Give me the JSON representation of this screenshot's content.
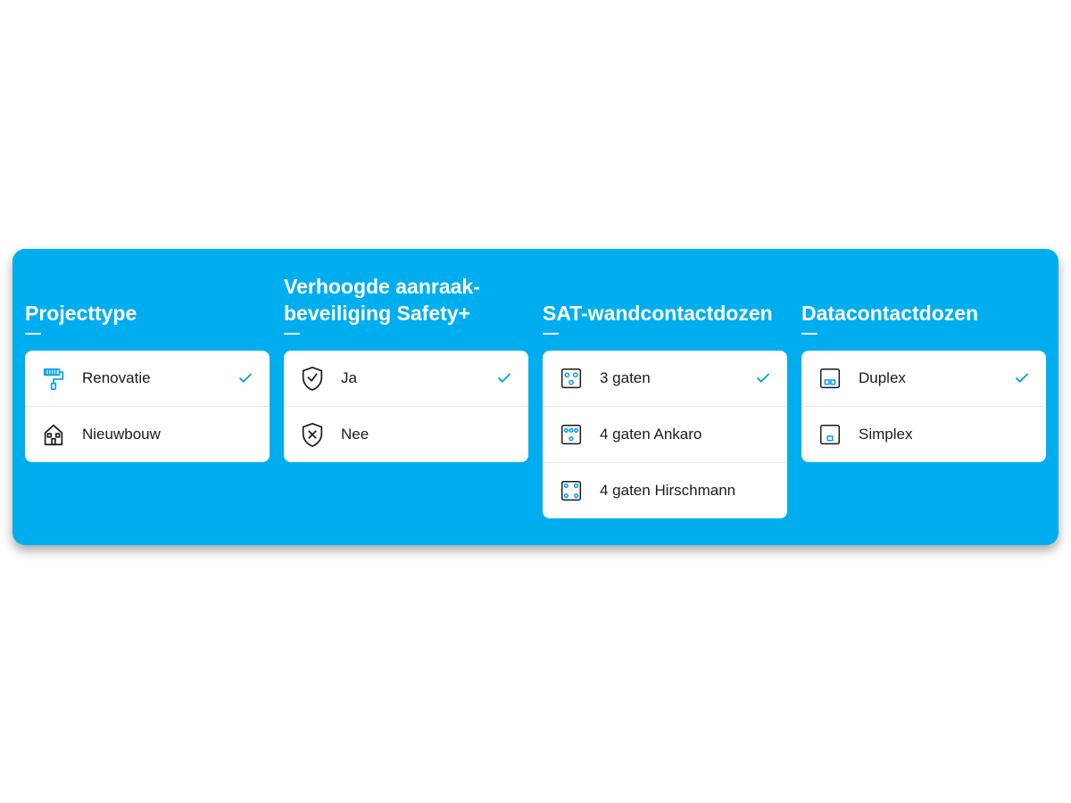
{
  "columns": [
    {
      "heading": "Projecttype",
      "options": [
        {
          "icon": "paint-roller-icon",
          "label": "Renovatie",
          "selected": true
        },
        {
          "icon": "house-icon",
          "label": "Nieuwbouw",
          "selected": false
        }
      ]
    },
    {
      "heading": "Verhoogde aanraak-beveiliging Safety+",
      "options": [
        {
          "icon": "shield-check-icon",
          "label": "Ja",
          "selected": true
        },
        {
          "icon": "shield-x-icon",
          "label": "Nee",
          "selected": false
        }
      ]
    },
    {
      "heading": "SAT-wandcontactdozen",
      "options": [
        {
          "icon": "socket-3-holes-icon",
          "label": "3 gaten",
          "selected": true
        },
        {
          "icon": "socket-4-top-icon",
          "label": "4 gaten Ankaro",
          "selected": false
        },
        {
          "icon": "socket-4-corner-icon",
          "label": "4 gaten Hirschmann",
          "selected": false
        }
      ]
    },
    {
      "heading": "Datacontactdozen",
      "options": [
        {
          "icon": "data-duplex-icon",
          "label": "Duplex",
          "selected": true
        },
        {
          "icon": "data-simplex-icon",
          "label": "Simplex",
          "selected": false
        }
      ]
    }
  ],
  "colors": {
    "panel": "#00aeef",
    "accent": "#009ee2"
  }
}
